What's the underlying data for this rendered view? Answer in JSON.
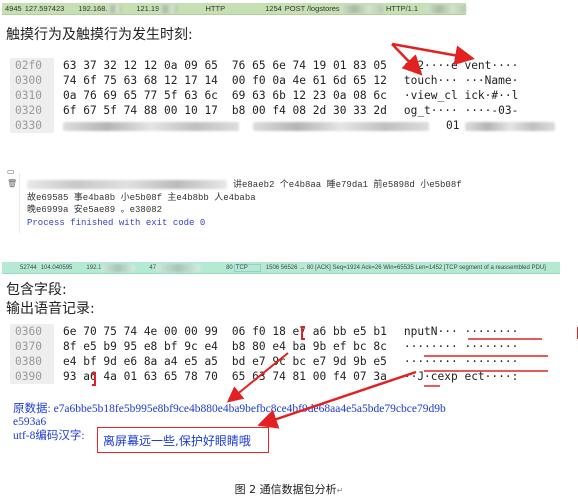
{
  "packet1": {
    "no": "4945",
    "time": "127.597423",
    "src": "192.168.",
    "dst": "121.19",
    "protocol": "HTTP",
    "length": "1254",
    "info": "POST /logstores",
    "version": "HTTP/1.1"
  },
  "section1_title": "触摸行为及触摸行为发生时刻:",
  "hex1": {
    "rows": [
      {
        "offset": "02f0",
        "bytes_a": "63 37 32 12 12 0a 09 65",
        "bytes_b": "76 65 6e 74 19 01 83 05",
        "ascii": "c72····e vent····"
      },
      {
        "offset": "0300",
        "bytes_a": "74 6f 75 63 68 12 17 14",
        "bytes_b": "00 f0 0a 4e 61 6d 65 12",
        "ascii": "touch··· ···Name·"
      },
      {
        "offset": "0310",
        "bytes_a": "0a 76 69 65 77 5f 63 6c",
        "bytes_b": "69 63 6b 12 23 0a 08 6c",
        "ascii": "·view_cl ick·#··l"
      },
      {
        "offset": "0320",
        "bytes_a": "6f 67 5f 74 88 00 10 17",
        "bytes_b": "b8 00 f4 08 2d 30 33 2d",
        "ascii": "og_t···· ····-03-"
      },
      {
        "offset": "0330",
        "bytes_a": "",
        "bytes_b": "",
        "ascii": "01"
      }
    ]
  },
  "console": {
    "lines": [
      "讲e8aeb2 个e4b8aa 睡e79da1 前e5898d 小e5b08f",
      "故e69585 事e4ba8b 小e5b08f 主e4b8bb 人e4baba",
      "晚e6999a 安e5ae89 。e38082"
    ],
    "process_line": "Process finished with exit code 0"
  },
  "packet2": {
    "no": "52744",
    "time": "104.040595",
    "src": "192.1",
    "dst": "47",
    "port": "80",
    "protocol": "TCP",
    "info": "1506 56526 → 80 [ACK] Seq=1924 Ack=26 Win=65535 Len=1452 [TCP segment of a reassembled PDU]"
  },
  "section2_title": "包含字段:",
  "section3_title": "输出语音记录:",
  "hex2": {
    "rows": [
      {
        "offset": "0360",
        "bytes_a": "6e 70 75 74 4e 00 00 99",
        "bytes_b": "06 f0 18 e7 a6 bb e5 b1",
        "ascii": "nputN··· ········"
      },
      {
        "offset": "0370",
        "bytes_a": "8f e5 b9 95 e8 bf 9c e4",
        "bytes_b": "b8 80 e4 ba 9b ef bc 8c",
        "ascii": "········ ········"
      },
      {
        "offset": "0380",
        "bytes_a": "e4 bf 9d e6 8a a4 e5 a5",
        "bytes_b": "bd e7 9c bc e7 9d 9b e5",
        "ascii": "········ ········"
      },
      {
        "offset": "0390",
        "bytes_a": "93 a6 4a 01 63 65 78 70",
        "bytes_b": "65 63 74 81 00 f4 07 3a",
        "ascii": "··J·cexp ect····:"
      }
    ]
  },
  "raw_label": "原数据:",
  "raw_data": "e7a6bbe5b18fe5b995e8bf9ce4b880e4ba9befbc8ce4bf9de68aa4e5a5bde79cbce79d9b",
  "raw_data_cont": "e593a6",
  "utf8_label": "utf-8编码汉字:",
  "utf8_text": "离屏幕远一些,保护好眼睛哦",
  "caption": "图 2  通信数据包分析",
  "caption_mark": "↵",
  "colors": {
    "packet1_bg": "#c6e0b4",
    "packet2_bg": "#b5ead2",
    "annotation_red": "#e22222",
    "result_blue": "#1d3bd6",
    "console_process": "#3742c3"
  }
}
